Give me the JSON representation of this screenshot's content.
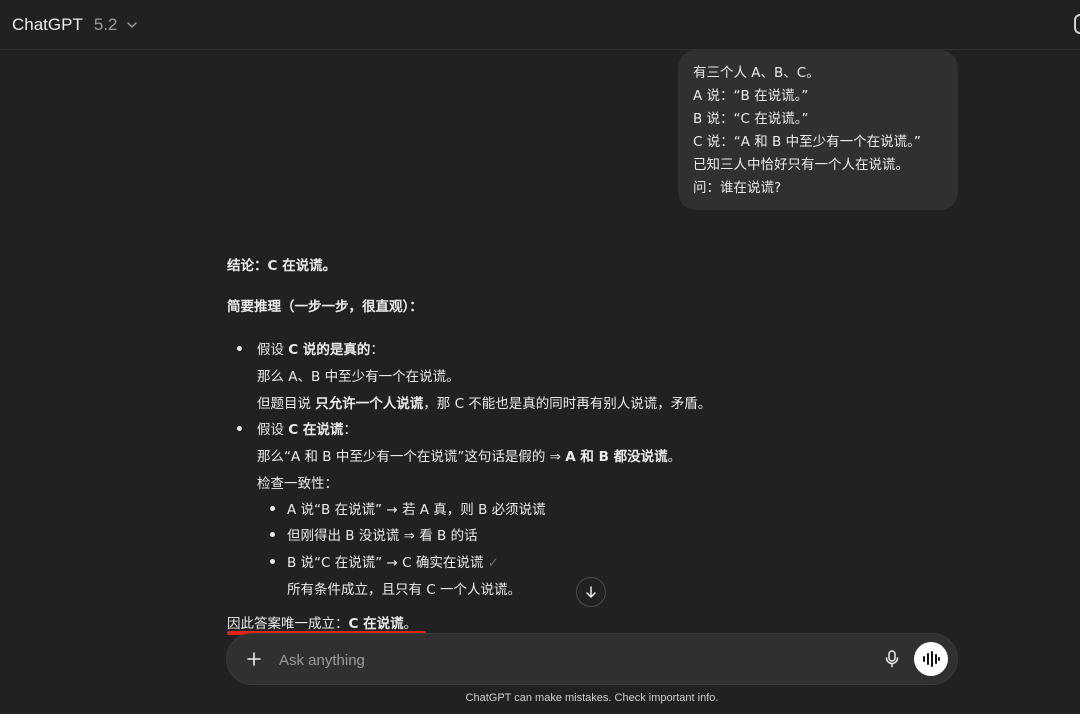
{
  "header": {
    "model_name": "ChatGPT",
    "model_version": "5.2"
  },
  "user_message": {
    "lines": [
      "有三个人 A、B、C。",
      "A 说：“B 在说谎。”",
      "B 说：“C 在说谎。”",
      "C 说：“A 和 B 中至少有一个在说谎。”",
      "已知三人中恰好只有一个人在说谎。",
      "问：谁在说谎?"
    ]
  },
  "answer": {
    "conclusion_label": "结论：",
    "conclusion_value": "C 在说谎。",
    "reasoning_heading": "简要推理（一步一步，很直观）：",
    "case1": {
      "lead": "假设 ",
      "bold": "C 说的是真的",
      "tail": "：",
      "line1": "那么 A、B 中至少有一个在说谎。",
      "line2_a": "但题目说 ",
      "line2_bold": "只允许一个人说谎",
      "line2_b": "，那 C 不能也是真的同时再有别人说谎，矛盾。"
    },
    "case2": {
      "lead": "假设 ",
      "bold": "C 在说谎",
      "tail": "：",
      "line1_a": "那么“A 和 B 中至少有一个在说谎”这句话是假的 ⇒ ",
      "line1_bold": "A 和 B 都没说谎",
      "line1_b": "。",
      "check_heading": "检查一致性：",
      "checks": [
        "A 说“B 在说谎” → 若 A 真，则 B 必须说谎",
        "但刚得出 B 没说谎 ⇒ 看 B 的话",
        "B 说“C 在说谎” → C 确实在说谎"
      ],
      "check_mark": "✓",
      "final_line": "所有条件成立，且只有 C 一个人说谎。"
    },
    "final_a": "因此答案唯一成立：",
    "final_bold": "C 在说谎",
    "final_b": "。"
  },
  "composer": {
    "placeholder": "Ask anything"
  },
  "footer": {
    "disclaimer": "ChatGPT can make mistakes. Check important info."
  },
  "colors": {
    "background": "#212121",
    "bubble": "#303030",
    "highlight_underline": "#e2231a"
  }
}
